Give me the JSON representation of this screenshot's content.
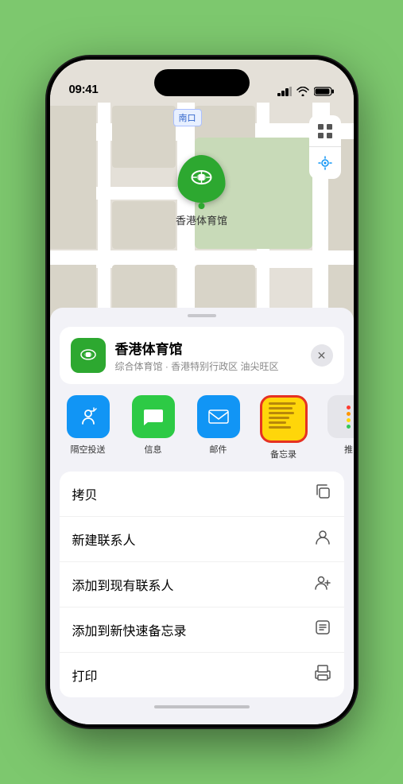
{
  "statusBar": {
    "time": "09:41",
    "signal": "▌▌▌",
    "wifi": "WiFi",
    "battery": "Bat"
  },
  "map": {
    "label": "南口"
  },
  "pin": {
    "label": "香港体育馆"
  },
  "venueCard": {
    "name": "香港体育馆",
    "subtitle": "综合体育馆 · 香港特别行政区 油尖旺区",
    "closeLabel": "✕"
  },
  "actions": [
    {
      "id": "airdrop",
      "label": "隔空投送"
    },
    {
      "id": "messages",
      "label": "信息"
    },
    {
      "id": "mail",
      "label": "邮件"
    },
    {
      "id": "notes",
      "label": "备忘录"
    },
    {
      "id": "more",
      "label": "推"
    }
  ],
  "menuItems": [
    {
      "label": "拷贝",
      "icon": "copy"
    },
    {
      "label": "新建联系人",
      "icon": "person"
    },
    {
      "label": "添加到现有联系人",
      "icon": "person-add"
    },
    {
      "label": "添加到新快速备忘录",
      "icon": "memo"
    },
    {
      "label": "打印",
      "icon": "print"
    }
  ]
}
